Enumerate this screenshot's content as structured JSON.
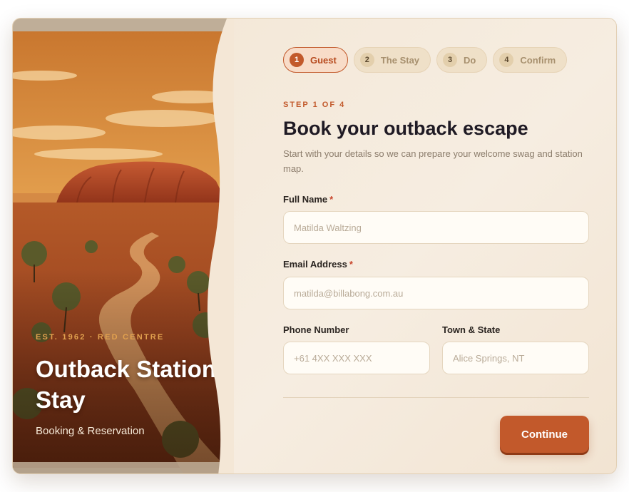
{
  "hero": {
    "eyebrow": "EST. 1962 · RED CENTRE",
    "title": "Outback Station Stay",
    "subtitle": "Booking & Reservation",
    "image_description_icon": "outback-landscape-illustration"
  },
  "steps": [
    {
      "number": "1",
      "label": "Guest",
      "active": true
    },
    {
      "number": "2",
      "label": "The Stay",
      "active": false
    },
    {
      "number": "3",
      "label": "Do",
      "active": false
    },
    {
      "number": "4",
      "label": "Confirm",
      "active": false
    }
  ],
  "form": {
    "step_counter": "STEP 1 OF 4",
    "heading": "Book your outback escape",
    "intro": "Start with your details so we can prepare your welcome swag and station map.",
    "full_name": {
      "label": "Full Name",
      "required_mark": "*",
      "placeholder": "Matilda Waltzing",
      "value": ""
    },
    "email": {
      "label": "Email Address",
      "required_mark": "*",
      "placeholder": "matilda@billabong.com.au",
      "value": ""
    },
    "phone": {
      "label": "Phone Number",
      "placeholder": "+61 4XX XXX XXX",
      "value": ""
    },
    "town": {
      "label": "Town & State",
      "placeholder": "Alice Springs, NT",
      "value": ""
    },
    "continue_label": "Continue"
  },
  "colors": {
    "accent": "#c2592b",
    "panel_background": "#f4e8d8",
    "heading_text": "#1f1a24",
    "eyebrow": "#e2a24f"
  }
}
